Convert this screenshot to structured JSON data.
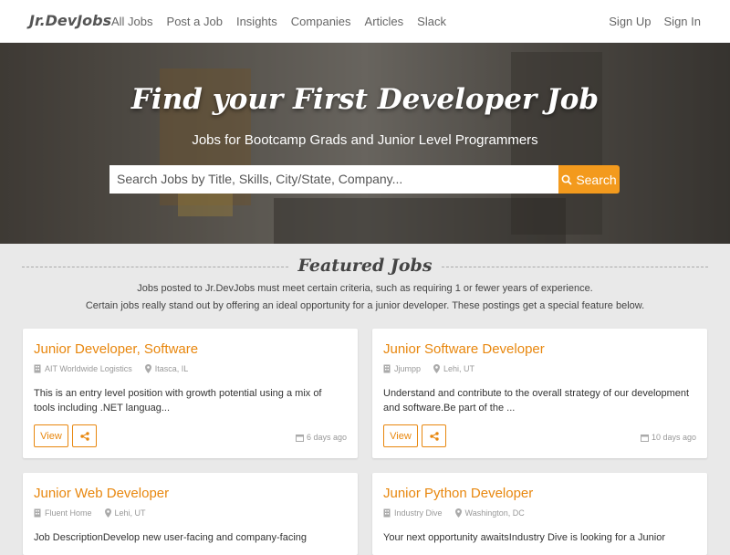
{
  "nav": {
    "brand": "Jr.DevJobs",
    "links": [
      "All Jobs",
      "Post a Job",
      "Insights",
      "Companies",
      "Articles",
      "Slack"
    ],
    "right": [
      "Sign Up",
      "Sign In"
    ]
  },
  "hero": {
    "title": "Find your First Developer Job",
    "subtitle": "Jobs for Bootcamp Grads and Junior Level Programmers",
    "search_placeholder": "Search Jobs by Title, Skills, City/State, Company...",
    "search_button": "Search"
  },
  "featured": {
    "title": "Featured Jobs",
    "desc1": "Jobs posted to Jr.DevJobs must meet certain criteria, such as requiring 1 or fewer years of experience.",
    "desc2": "Certain jobs really stand out by offering an ideal opportunity for a junior developer. These postings get a special feature below."
  },
  "jobs": [
    {
      "title": "Junior Developer, Software",
      "company": "AIT Worldwide Logistics",
      "location": "Itasca, IL",
      "description": "This is an entry level position with growth potential using a mix of tools including .NET languag...",
      "view": "View",
      "posted": "6 days ago"
    },
    {
      "title": "Junior Software Developer",
      "company": "Jjumpp",
      "location": "Lehi, UT",
      "description": "Understand and contribute to the overall strategy of our development and software.Be part of the ...",
      "view": "View",
      "posted": "10 days ago"
    },
    {
      "title": "Junior Web Developer",
      "company": "Fluent Home",
      "location": "Lehi, UT",
      "description": "Job DescriptionDevelop new user-facing and company-facing"
    },
    {
      "title": "Junior Python Developer",
      "company": "Industry Dive",
      "location": "Washington, DC",
      "description": "Your next opportunity awaitsIndustry Dive is looking for a Junior"
    }
  ],
  "colors": {
    "accent": "#e8870e",
    "search_button": "#f39a1d"
  }
}
